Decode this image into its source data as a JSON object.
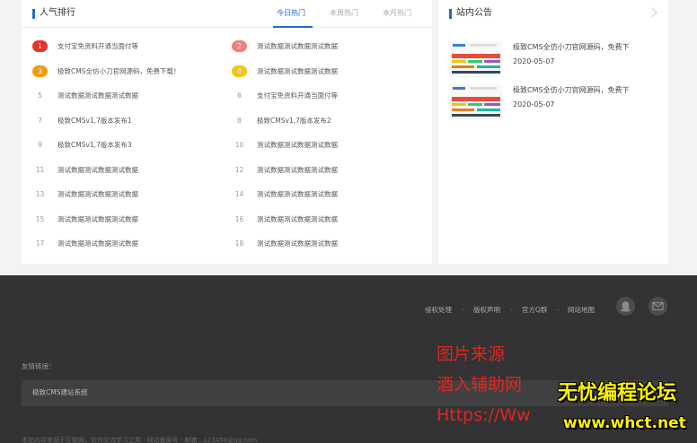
{
  "ranking": {
    "title": "人气排行",
    "tabs": [
      {
        "label": "今日热门",
        "active": true
      },
      {
        "label": "本周热门",
        "active": false
      },
      {
        "label": "本月热门",
        "active": false
      }
    ],
    "items": [
      {
        "num": "1",
        "text": "支付宝免资料开通当面付等"
      },
      {
        "num": "2",
        "text": "测试数据测试数据测试数据"
      },
      {
        "num": "3",
        "text": "极致CMS全仿小刀官网源码，免费下载！"
      },
      {
        "num": "4",
        "text": "测试数据测试数据测试数据"
      },
      {
        "num": "5",
        "text": "测试数据测试数据测试数据"
      },
      {
        "num": "6",
        "text": "支付宝免资料开通当面付等"
      },
      {
        "num": "7",
        "text": "极致CMSv1,7版本发布1"
      },
      {
        "num": "8",
        "text": "极致CMSv1,7版本发布2"
      },
      {
        "num": "9",
        "text": "极致CMSv1,7版本发布3"
      },
      {
        "num": "10",
        "text": "测试数据测试数据测试数据"
      },
      {
        "num": "11",
        "text": "测试数据测试数据测试数据"
      },
      {
        "num": "12",
        "text": "测试数据测试数据测试数据"
      },
      {
        "num": "13",
        "text": "测试数据测试数据测试数据"
      },
      {
        "num": "14",
        "text": "测试数据测试数据测试数据"
      },
      {
        "num": "15",
        "text": "测试数据测试数据测试数据"
      },
      {
        "num": "16",
        "text": "测试数据测试数据测试数据"
      },
      {
        "num": "17",
        "text": "测试数据测试数据测试数据"
      },
      {
        "num": "18",
        "text": "测试数据测试数据测试数据"
      }
    ]
  },
  "notice": {
    "title": "站内公告",
    "items": [
      {
        "title": "极致CMS全仿小刀官网源码，免费下",
        "date": "2020-05-07"
      },
      {
        "title": "极致CMS全仿小刀官网源码，免费下",
        "date": "2020-05-07"
      }
    ]
  },
  "footer": {
    "links": [
      "侵权处理",
      "版权声明",
      "官方Q群",
      "网站地图"
    ],
    "separator": "-",
    "friend_label": "友情链接：",
    "friend_link": "极致CMS建站系统",
    "copyright": "本站内容来源于互联网，仅作交流学习之用 · 网站备案号 · 邮箱：123456@qq.com"
  },
  "watermark": {
    "line1": "图片来源",
    "line2": "酒入辅助网",
    "line3": "Https://Ww",
    "logo_line1": "无忧编程论坛",
    "logo_line2": "www.whct.net"
  },
  "colors": {
    "accent": "#1c6ccf",
    "rank1": "#e8322d",
    "rank2": "#f08080",
    "rank3": "#f39c12",
    "rank4": "#f5c518",
    "footer_bg": "#333335"
  },
  "icons": [
    "qq-icon",
    "mail-icon",
    "chevron-right-icon"
  ]
}
